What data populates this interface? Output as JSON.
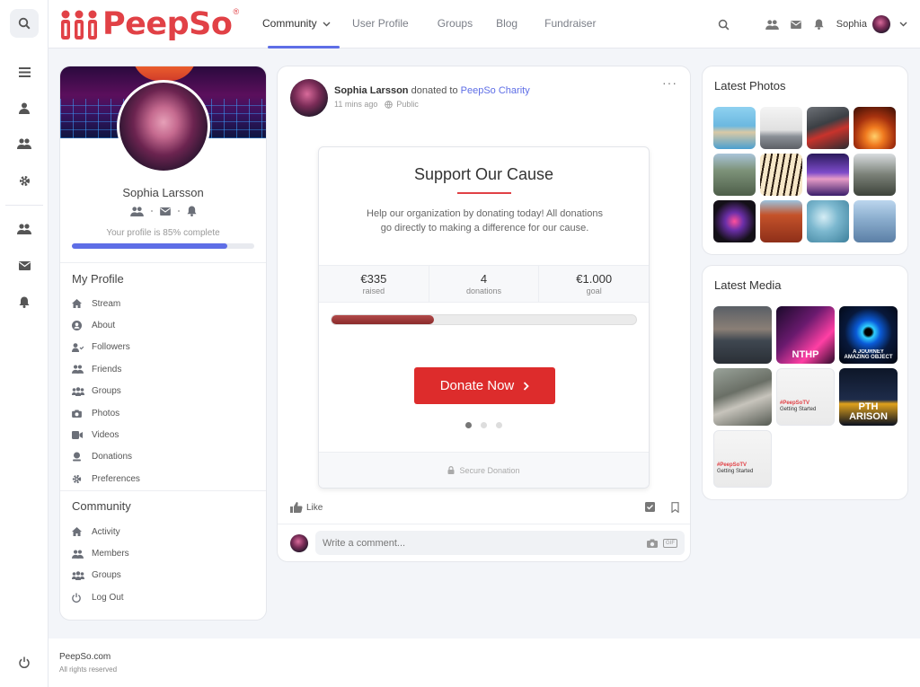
{
  "brand": {
    "name": "PeepSo",
    "trademark": "®",
    "color": "#e14146"
  },
  "accent": "#5e6ee6",
  "nav": [
    {
      "label": "Community",
      "active": true,
      "dropdown": true
    },
    {
      "label": "User Profile"
    },
    {
      "label": "Groups"
    },
    {
      "label": "Blog"
    },
    {
      "label": "Fundraiser"
    }
  ],
  "header": {
    "username": "Sophia"
  },
  "rail_icons": [
    "search-icon",
    "menu-icon",
    "user-icon",
    "members-icon",
    "gear-icon",
    "friends-icon",
    "mail-icon",
    "bell-icon",
    "power-icon"
  ],
  "profile": {
    "name": "Sophia Larsson",
    "completion_text": "Your profile is 85% complete",
    "completion": 0.85,
    "my_profile_title": "My Profile",
    "my_profile_items": [
      {
        "label": "Stream",
        "icon": "home-icon"
      },
      {
        "label": "About",
        "icon": "user-circle-icon"
      },
      {
        "label": "Followers",
        "icon": "followers-icon"
      },
      {
        "label": "Friends",
        "icon": "friends-icon"
      },
      {
        "label": "Groups",
        "icon": "groups-icon"
      },
      {
        "label": "Photos",
        "icon": "camera-icon"
      },
      {
        "label": "Videos",
        "icon": "video-icon"
      },
      {
        "label": "Donations",
        "icon": "donation-icon"
      },
      {
        "label": "Preferences",
        "icon": "gear-icon"
      }
    ],
    "community_title": "Community",
    "community_items": [
      {
        "label": "Activity",
        "icon": "home-icon"
      },
      {
        "label": "Members",
        "icon": "members-icon"
      },
      {
        "label": "Groups",
        "icon": "groups-icon"
      },
      {
        "label": "Log Out",
        "icon": "power-icon"
      }
    ]
  },
  "post": {
    "author": "Sophia Larsson",
    "action": "donated to",
    "target": "PeepSo Charity",
    "time": "11 mins ago",
    "privacy": "Public",
    "like_label": "Like",
    "comment_placeholder": "Write a comment...",
    "donation": {
      "title": "Support Our Cause",
      "description": "Help our organization by donating today! All donations go directly to making a difference for our cause.",
      "stats": [
        {
          "value": "€335",
          "label": "raised"
        },
        {
          "value": "4",
          "label": "donations"
        },
        {
          "value": "€1.000",
          "label": "goal"
        }
      ],
      "progress": 0.335,
      "button_label": "Donate Now",
      "secure_label": "Secure Donation",
      "carousel_dots": 3,
      "carousel_active": 0
    }
  },
  "latest_photos": {
    "title": "Latest Photos",
    "tiles": [
      "coastal-city",
      "lightbulbs-laptop",
      "formula-race",
      "olympic-sunset",
      "apartment-building",
      "piano-keys",
      "purple-landscape",
      "city-tower",
      "neon-drone",
      "red-canyon",
      "water-drops",
      "skyscrapers"
    ]
  },
  "latest_media": {
    "title": "Latest Media",
    "tiles": [
      {
        "kind": "harbor-dusk"
      },
      {
        "kind": "neon-portrait",
        "text": "NTHP"
      },
      {
        "kind": "blue-eye",
        "text": "A JOURNEY AMAZING OBJECT"
      },
      {
        "kind": "aerial-city"
      },
      {
        "kind": "peepsotv",
        "text": "#PeepSoTV",
        "sub": "Getting Started"
      },
      {
        "kind": "night-bridge",
        "text": "PTH ARISON"
      },
      {
        "kind": "peepsotv",
        "text": "#PeepSoTV",
        "sub": "Getting Started"
      }
    ]
  },
  "footer": {
    "site": "PeepSo.com",
    "rights": "All rights reserved"
  }
}
